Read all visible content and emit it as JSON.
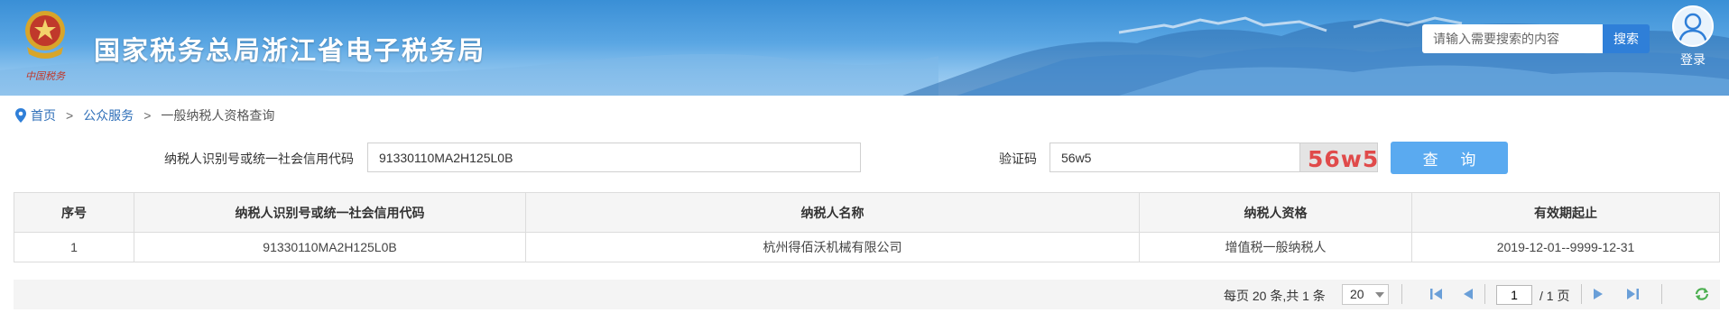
{
  "header": {
    "site_title": "国家税务总局浙江省电子税务局",
    "search_placeholder": "请输入需要搜索的内容",
    "search_button": "搜索",
    "login_label": "登录",
    "emblem_icon": "tax-emblem-icon",
    "banner_colors": [
      "#3a8fd6",
      "#a9d2f2"
    ]
  },
  "breadcrumb": {
    "home": "首页",
    "separator": ">",
    "section": "公众服务",
    "current": "一般纳税人资格查询"
  },
  "query": {
    "taxpayer_id_label": "纳税人识别号或统一社会信用代码",
    "taxpayer_id_value": "91330110MA2H125L0B",
    "captcha_label": "验证码",
    "captcha_value": "56w5",
    "captcha_image_text": "56w5",
    "submit_label": "查 询",
    "accent_color": "#5aaaf0"
  },
  "table": {
    "headers": [
      "序号",
      "纳税人识别号或统一社会信用代码",
      "纳税人名称",
      "纳税人资格",
      "有效期起止"
    ],
    "rows": [
      [
        "1",
        "91330110MA2H125L0B",
        "杭州得佰沃机械有限公司",
        "增值税一般纳税人",
        "2019-12-01--9999-12-31"
      ]
    ]
  },
  "pager": {
    "summary": "每页 20 条,共 1 条",
    "page_size": "20",
    "current_page": "1",
    "total_pages": "/ 1 页",
    "icons": [
      "first-page-icon",
      "prev-page-icon",
      "next-page-icon",
      "last-page-icon",
      "refresh-icon"
    ]
  }
}
